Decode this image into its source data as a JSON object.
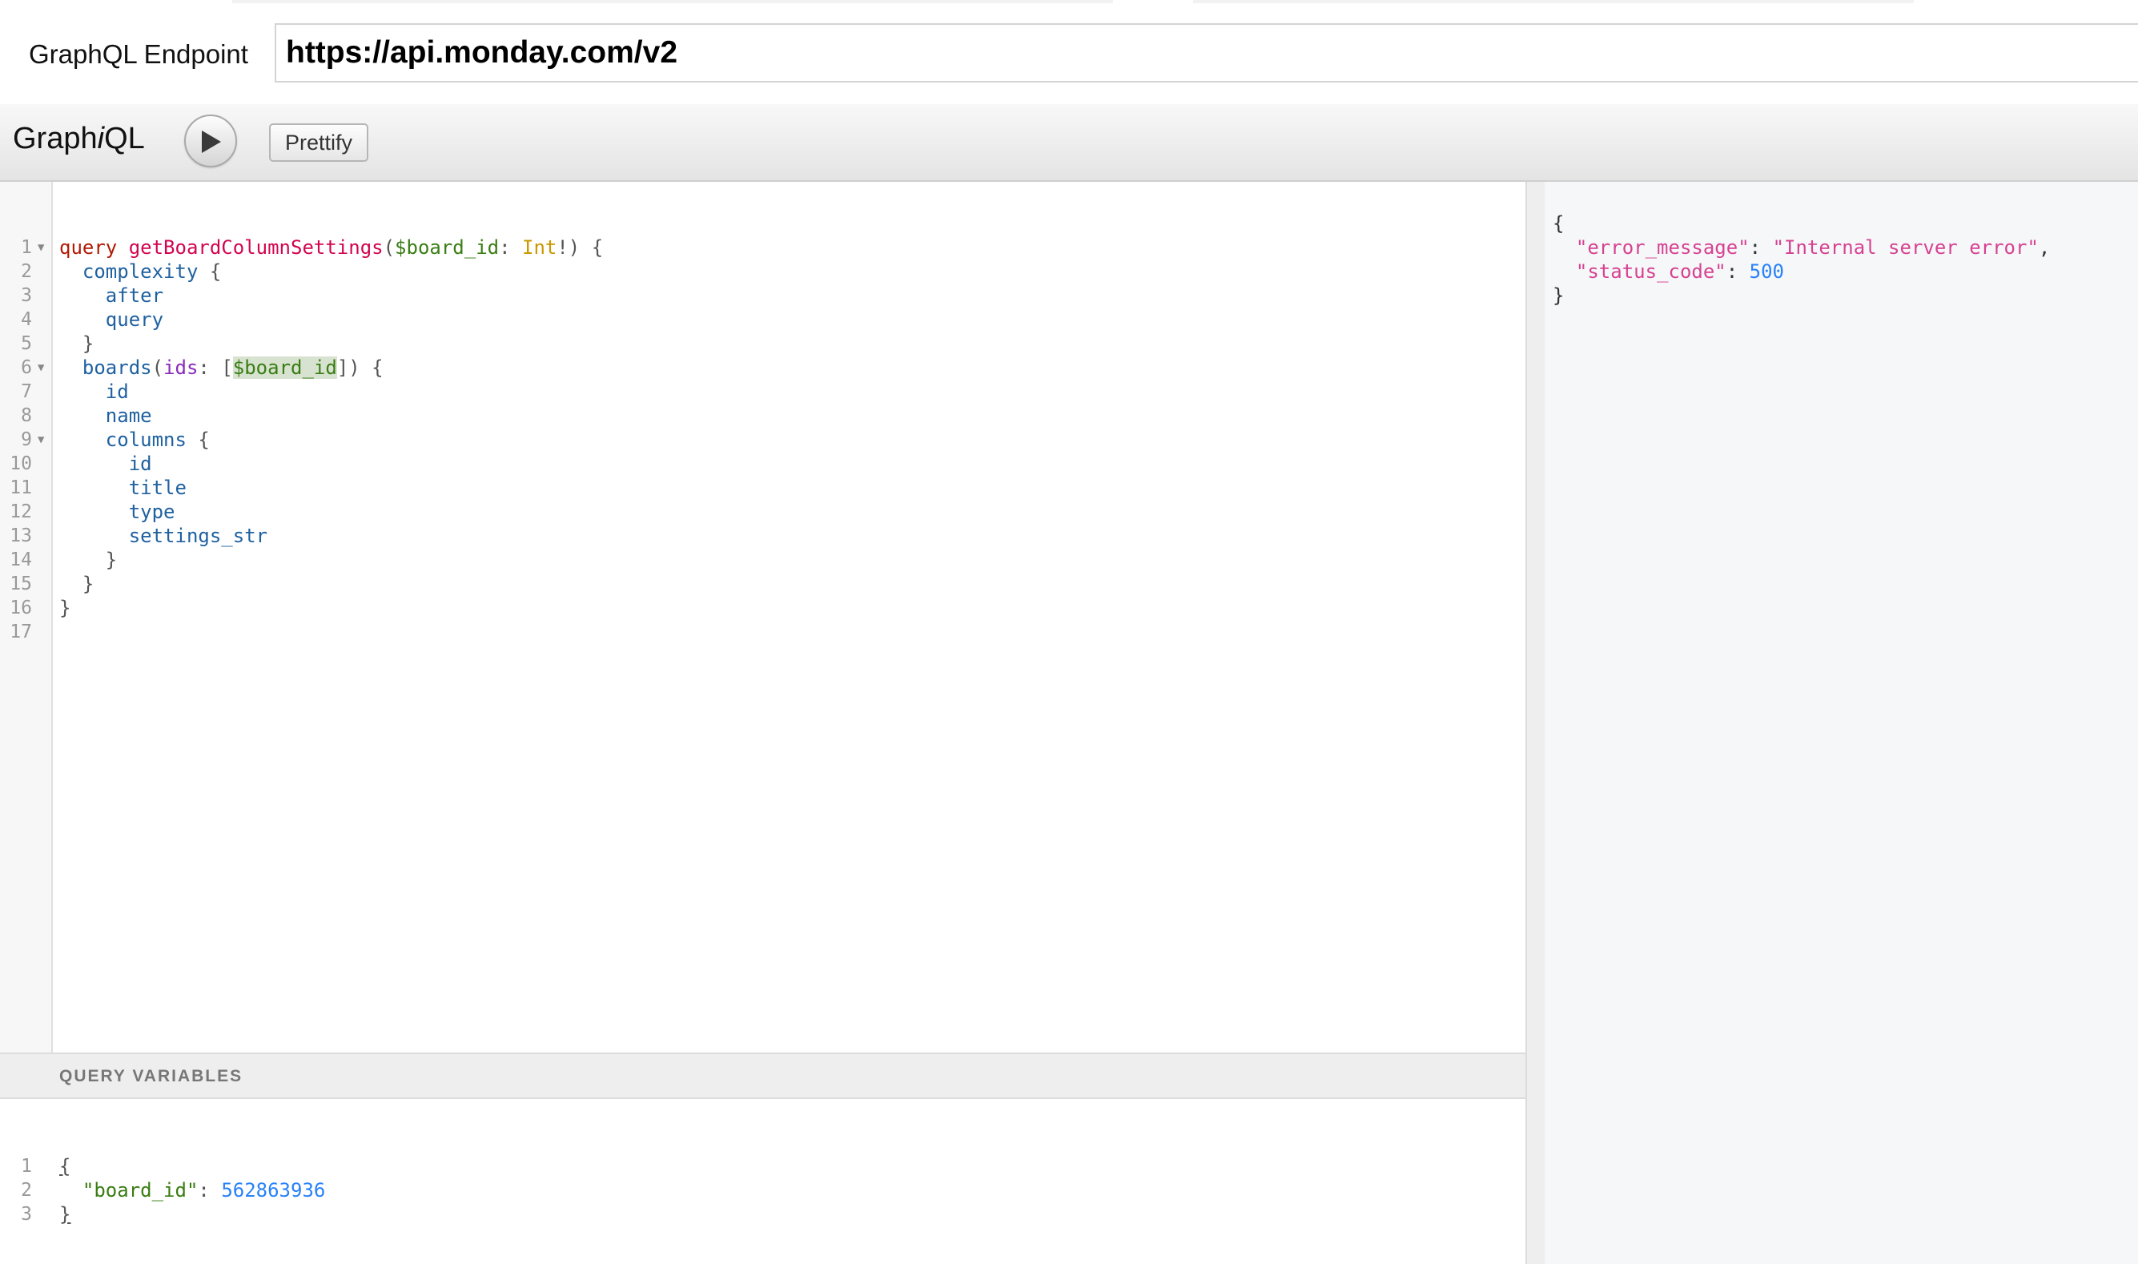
{
  "endpoint": {
    "label": "GraphQL Endpoint",
    "url": "https://api.monday.com/v2"
  },
  "toolbar": {
    "logo_prefix": "Graph",
    "logo_i": "i",
    "logo_suffix": "QL",
    "run_icon": "play-icon",
    "prettify_label": "Prettify"
  },
  "query_editor": {
    "line_numbers": [
      "1",
      "2",
      "3",
      "4",
      "5",
      "6",
      "7",
      "8",
      "9",
      "10",
      "11",
      "12",
      "13",
      "14",
      "15",
      "16",
      "17"
    ],
    "keyword": "query",
    "operation_name": "getBoardColumnSettings",
    "var_name": "$board_id",
    "var_type": "Int",
    "fields": {
      "complexity": "complexity",
      "after": "after",
      "query": "query",
      "boards": "boards",
      "ids_arg": "ids",
      "board_var": "$board_id",
      "id": "id",
      "name": "name",
      "columns": "columns",
      "col_id": "id",
      "title": "title",
      "type": "type",
      "settings_str": "settings_str"
    }
  },
  "variables_panel": {
    "title": "QUERY VARIABLES",
    "line_numbers": [
      "1",
      "2",
      "3"
    ],
    "key": "\"board_id\"",
    "value": "562863936"
  },
  "result": {
    "key1": "\"error_message\"",
    "value1": "\"Internal server error\"",
    "key2": "\"status_code\"",
    "value2": "500"
  }
}
